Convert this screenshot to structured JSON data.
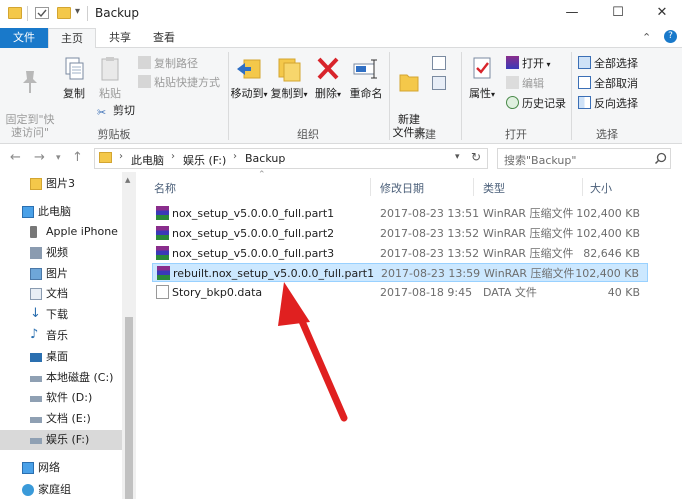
{
  "window": {
    "title": "Backup",
    "minimize": "—",
    "maximize": "☐",
    "close": "✕",
    "help": "?",
    "collapse": "⌃"
  },
  "ribbon_tabs": {
    "file": "文件",
    "home": "主页",
    "share": "共享",
    "view": "查看"
  },
  "ribbon": {
    "clipboard": {
      "label": "剪贴板",
      "pin": "固定到\"快\n速访问\"",
      "copy": "复制",
      "paste": "粘贴",
      "copy_path": "复制路径",
      "paste_shortcut": "粘贴快捷方式",
      "cut": "剪切"
    },
    "organize": {
      "label": "组织",
      "move_to": "移动到",
      "copy_to": "复制到",
      "delete": "删除",
      "rename": "重命名"
    },
    "new": {
      "label": "新建",
      "new_folder": "新建\n文件夹"
    },
    "open": {
      "label": "打开",
      "properties": "属性",
      "open": "打开",
      "edit": "编辑",
      "history": "历史记录"
    },
    "select": {
      "label": "选择",
      "select_all": "全部选择",
      "select_none": "全部取消",
      "invert": "反向选择"
    }
  },
  "address": {
    "path": [
      "此电脑",
      "娱乐 (F:)",
      "Backup"
    ],
    "search_placeholder": "搜索\"Backup\""
  },
  "nav": {
    "items": [
      {
        "label": "图片3",
        "icon": "folder-icon"
      },
      {
        "label": "此电脑",
        "icon": "computer-icon"
      },
      {
        "label": "Apple iPhone",
        "icon": "phone-icon"
      },
      {
        "label": "视频",
        "icon": "video-icon"
      },
      {
        "label": "图片",
        "icon": "pictures-icon"
      },
      {
        "label": "文档",
        "icon": "documents-icon"
      },
      {
        "label": "下载",
        "icon": "download-icon"
      },
      {
        "label": "音乐",
        "icon": "music-icon"
      },
      {
        "label": "桌面",
        "icon": "desktop-icon"
      },
      {
        "label": "本地磁盘 (C:)",
        "icon": "drive-icon"
      },
      {
        "label": "软件 (D:)",
        "icon": "drive-icon"
      },
      {
        "label": "文档 (E:)",
        "icon": "drive-icon"
      },
      {
        "label": "娱乐 (F:)",
        "icon": "drive-icon"
      },
      {
        "label": "网络",
        "icon": "network-icon"
      },
      {
        "label": "家庭组",
        "icon": "homegroup-icon"
      }
    ]
  },
  "columns": {
    "name": "名称",
    "date": "修改日期",
    "type": "类型",
    "size": "大小"
  },
  "files": [
    {
      "name": "nox_setup_v5.0.0.0_full.part1",
      "date": "2017-08-23 13:51",
      "type": "WinRAR 压缩文件",
      "size": "102,400 KB"
    },
    {
      "name": "nox_setup_v5.0.0.0_full.part2",
      "date": "2017-08-23 13:52",
      "type": "WinRAR 压缩文件",
      "size": "102,400 KB"
    },
    {
      "name": "nox_setup_v5.0.0.0_full.part3",
      "date": "2017-08-23 13:52",
      "type": "WinRAR 压缩文件",
      "size": "82,646 KB"
    },
    {
      "name": "rebuilt.nox_setup_v5.0.0.0_full.part1",
      "date": "2017-08-23 13:59",
      "type": "WinRAR 压缩文件",
      "size": "102,400 KB"
    },
    {
      "name": "Story_bkp0.data",
      "date": "2017-08-18 9:45",
      "type": "DATA 文件",
      "size": "40 KB"
    }
  ],
  "colors": {
    "accent": "#1979ca",
    "selection": "#cce8ff",
    "annotation_arrow": "#e02020"
  }
}
